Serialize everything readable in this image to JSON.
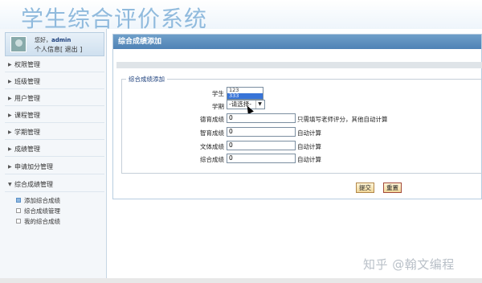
{
  "header": {
    "title": "学生综合评价系统"
  },
  "user": {
    "greeting": "您好，",
    "name": "admin",
    "links": "个人信息[ 退出 ]"
  },
  "sidebar": {
    "items": [
      "权限管理",
      "班级管理",
      "用户管理",
      "课程管理",
      "学期管理",
      "成绩管理",
      "申请加分管理",
      "综合成绩管理"
    ],
    "subitems": [
      "添加综合成绩",
      "综合成绩管理",
      "我的综合成绩"
    ]
  },
  "main": {
    "title": "综合成绩添加",
    "legend": "综合成绩添加",
    "student_label": "学生",
    "student_options": [
      "123",
      "333"
    ],
    "term_label": "学期",
    "term_value": "-请选择-",
    "fields": [
      {
        "label": "德育成绩",
        "value": "0",
        "hint": "只需填写老师评分，其他自动计算"
      },
      {
        "label": "智育成绩",
        "value": "0",
        "hint": "自动计算"
      },
      {
        "label": "文体成绩",
        "value": "0",
        "hint": "自动计算"
      },
      {
        "label": "综合成绩",
        "value": "0",
        "hint": "自动计算"
      }
    ],
    "submit": "提交",
    "reset": "重置"
  },
  "watermark": "知乎 @翰文编程"
}
